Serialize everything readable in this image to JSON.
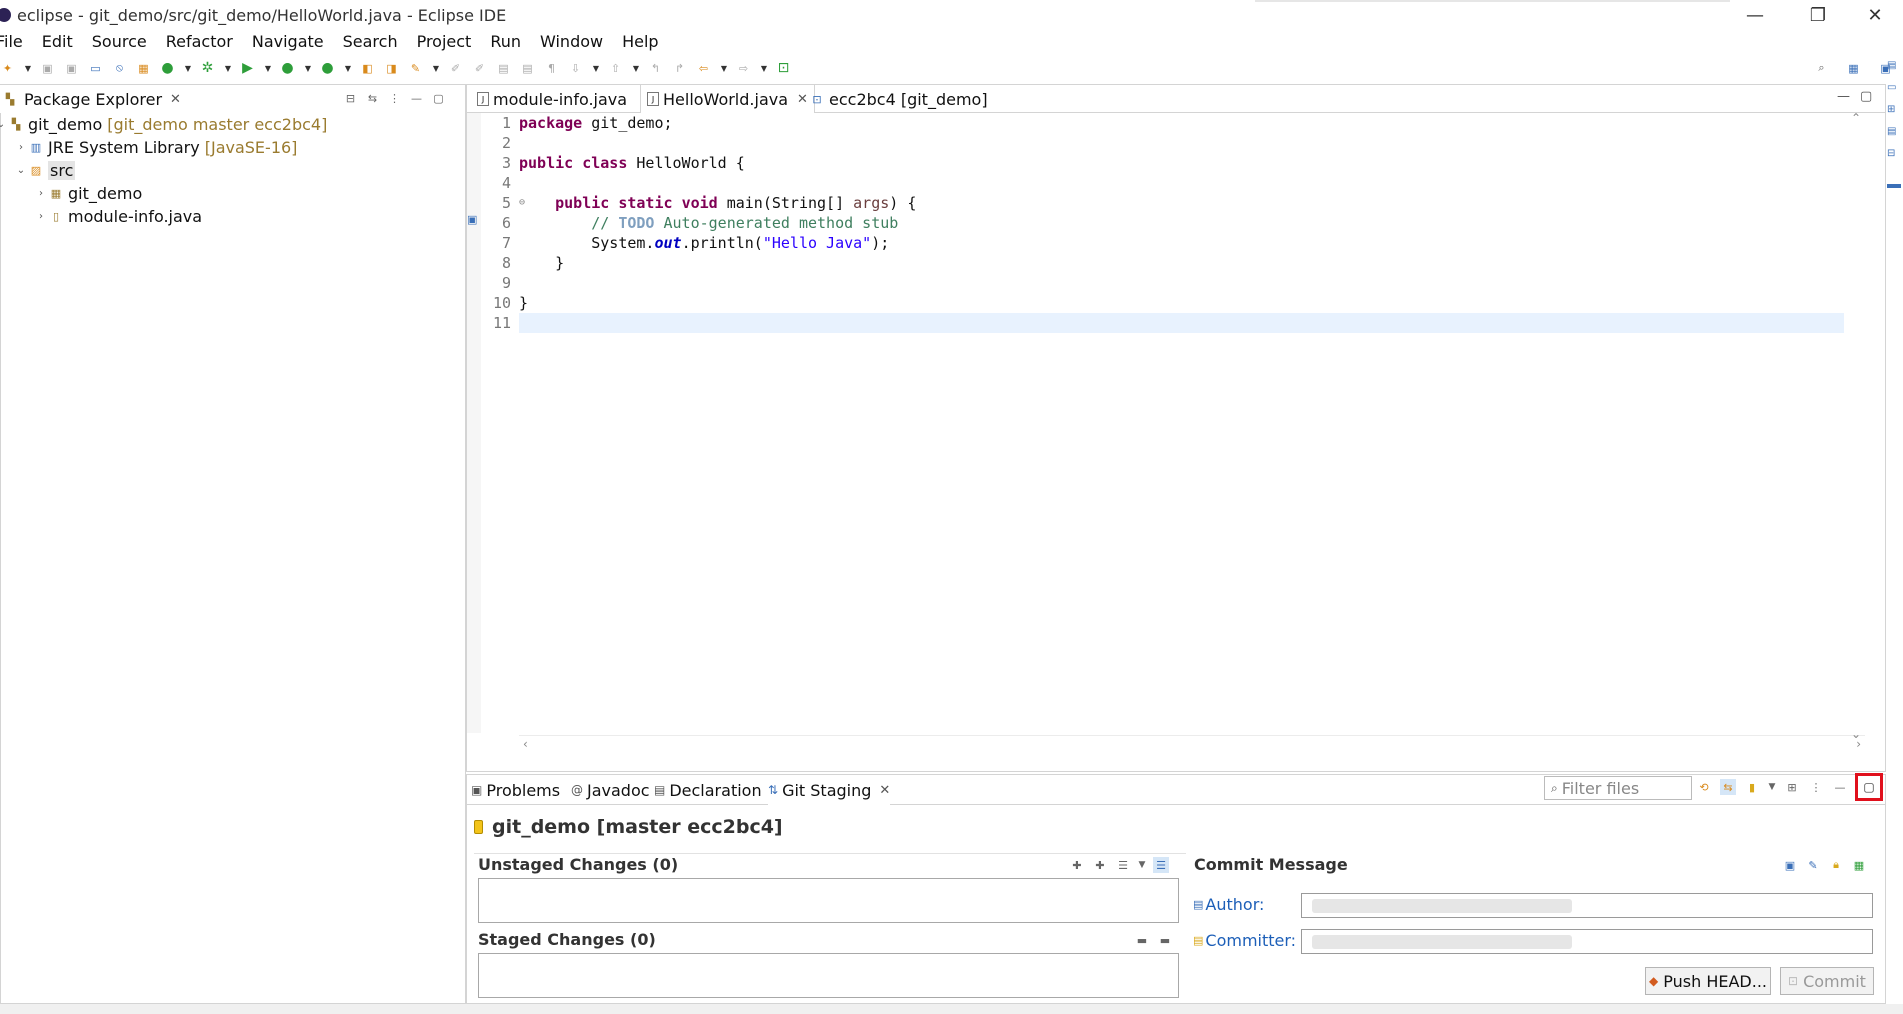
{
  "window": {
    "title": "eclipse - git_demo/src/git_demo/HelloWorld.java - Eclipse IDE",
    "controls": {
      "minimize": "—",
      "restore": "❐",
      "close": "✕"
    }
  },
  "menu": [
    "File",
    "Edit",
    "Source",
    "Refactor",
    "Navigate",
    "Search",
    "Project",
    "Run",
    "Window",
    "Help"
  ],
  "package_explorer": {
    "tab_label": "Package Explorer",
    "tree": [
      {
        "label": "git_demo",
        "decoration": "[git_demo master ecc2bc4]",
        "expanded": true,
        "icon": "project-icon"
      },
      {
        "label": "JRE System Library",
        "decoration": "[JavaSE-16]",
        "expanded": false,
        "icon": "library-icon"
      },
      {
        "label": "src",
        "decoration": "",
        "expanded": true,
        "icon": "source-folder-icon"
      },
      {
        "label": "git_demo",
        "decoration": "",
        "expanded": false,
        "icon": "package-icon"
      },
      {
        "label": "module-info.java",
        "decoration": "",
        "expanded": false,
        "icon": "java-file-icon"
      }
    ]
  },
  "editor": {
    "tabs": [
      {
        "label": "module-info.java",
        "active": false
      },
      {
        "label": "HelloWorld.java",
        "active": true
      },
      {
        "label": "ecc2bc4 [git_demo]",
        "active": false
      }
    ],
    "line_numbers": [
      "1",
      "2",
      "3",
      "4",
      "5",
      "6",
      "7",
      "8",
      "9",
      "10",
      "11"
    ],
    "code": {
      "l1_kw": "package",
      "l1_rest": " git_demo;",
      "l3_kw1": "public",
      "l3_kw2": "class",
      "l3_rest": " HelloWorld {",
      "l5_indent": "    ",
      "l5_kw1": "public",
      "l5_kw2": "static",
      "l5_kw3": "void",
      "l5_rest": " main(String[] ",
      "l5_arg": "args",
      "l5_end": ") {",
      "l6_indent": "        ",
      "l6_comment": "// ",
      "l6_todo": "TODO",
      "l6_comment2": " Auto-generated method stub",
      "l7_indent": "        ",
      "l7_a": "System.",
      "l7_field": "out",
      "l7_b": ".println(",
      "l7_str": "\"Hello Java\"",
      "l7_c": ");",
      "l8": "    }",
      "l10": "}"
    }
  },
  "bottom_view": {
    "tabs": [
      {
        "label": "Problems",
        "icon": "problems-icon"
      },
      {
        "label": "Javadoc",
        "icon": "javadoc-icon"
      },
      {
        "label": "Declaration",
        "icon": "declaration-icon"
      },
      {
        "label": "Git Staging",
        "icon": "git-staging-icon",
        "active": true
      }
    ],
    "filter_placeholder": "Filter files",
    "repository": "git_demo [master ecc2bc4]",
    "unstaged_title": "Unstaged Changes (0)",
    "staged_title": "Staged Changes (0)",
    "commit_message_title": "Commit Message",
    "author_label": "Author:",
    "committer_label": "Committer:",
    "push_button": "Push HEAD...",
    "commit_button": "Commit"
  },
  "colors": {
    "highlight_box": "#e0101c",
    "keyword": "#7f0055",
    "comment": "#3f7f5f",
    "string": "#2a00ff",
    "current_line": "#e8f2fe",
    "git_decoration": "#9a7b2f"
  }
}
